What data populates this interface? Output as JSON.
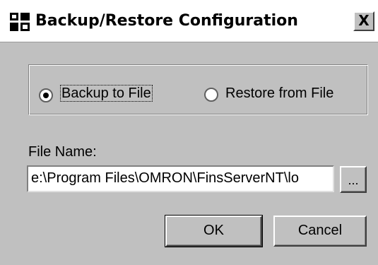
{
  "window": {
    "title": "Backup/Restore Configuration",
    "close_glyph": "X",
    "app_icon": "config-app-icon"
  },
  "mode": {
    "selected": "backup",
    "backup_label": "Backup to File",
    "restore_label": "Restore from File"
  },
  "file": {
    "label": "File Name:",
    "value": "e:\\Program Files\\OMRON\\FinsServerNT\\lo",
    "browse_label": "..."
  },
  "buttons": {
    "ok_label": "OK",
    "cancel_label": "Cancel"
  }
}
